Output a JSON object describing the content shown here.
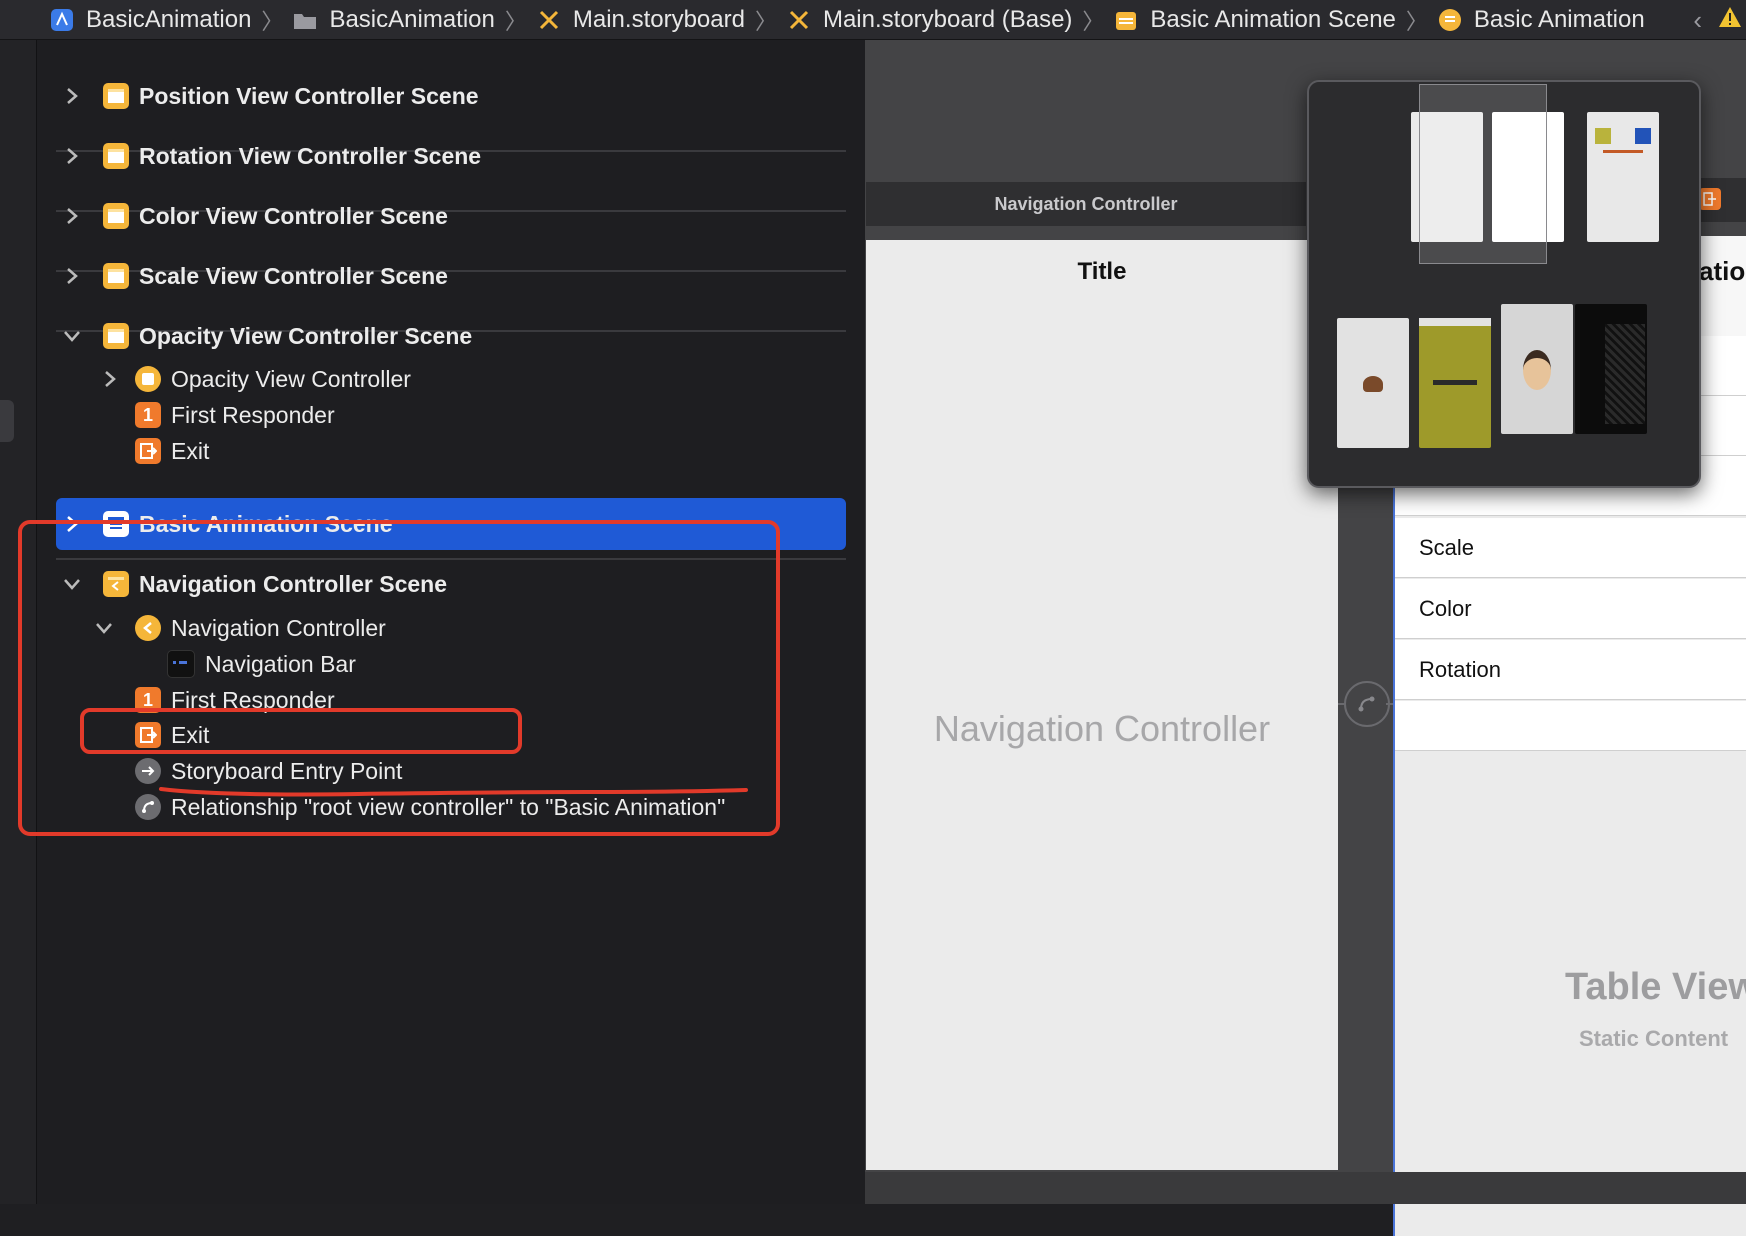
{
  "breadcrumb": [
    {
      "label": "BasicAnimation",
      "icon": "xcode-project-icon"
    },
    {
      "label": "BasicAnimation",
      "icon": "folder-icon"
    },
    {
      "label": "Main.storyboard",
      "icon": "storyboard-icon"
    },
    {
      "label": "Main.storyboard (Base)",
      "icon": "storyboard-icon"
    },
    {
      "label": "Basic Animation Scene",
      "icon": "scene-icon"
    },
    {
      "label": "Basic Animation",
      "icon": "view-controller-icon"
    }
  ],
  "outline": {
    "scenes": [
      {
        "label": "Position View Controller Scene"
      },
      {
        "label": "Rotation View Controller Scene"
      },
      {
        "label": "Color View Controller Scene"
      },
      {
        "label": "Scale View Controller Scene"
      },
      {
        "label": "Opacity View Controller Scene"
      }
    ],
    "opacity_children": {
      "vc": "Opacity View Controller",
      "first_responder": "First Responder",
      "exit": "Exit"
    },
    "basic_animation_scene": "Basic Animation Scene",
    "navigation_scene": {
      "label": "Navigation Controller Scene",
      "nav_controller": "Navigation Controller",
      "nav_bar": "Navigation Bar",
      "first_responder": "First Responder",
      "exit": "Exit",
      "entry_point": "Storyboard Entry Point",
      "relationship": "Relationship \"root view controller\" to \"Basic Animation\""
    },
    "first_responder_badge": "1"
  },
  "canvas": {
    "nav_header": "Navigation Controller",
    "nav_title": "Title",
    "nav_placeholder": "Navigation Controller",
    "table_header_partial": "atior",
    "table_rows": [
      "Scale",
      "Color",
      "Rotation"
    ],
    "table_title": "Table View",
    "table_subtitle": "Static Content"
  },
  "colors": {
    "selection": "#1f5ad6",
    "annotation": "#e23a2a",
    "scene_icon": "#f5b63a",
    "responder_icon": "#f07a2c"
  }
}
